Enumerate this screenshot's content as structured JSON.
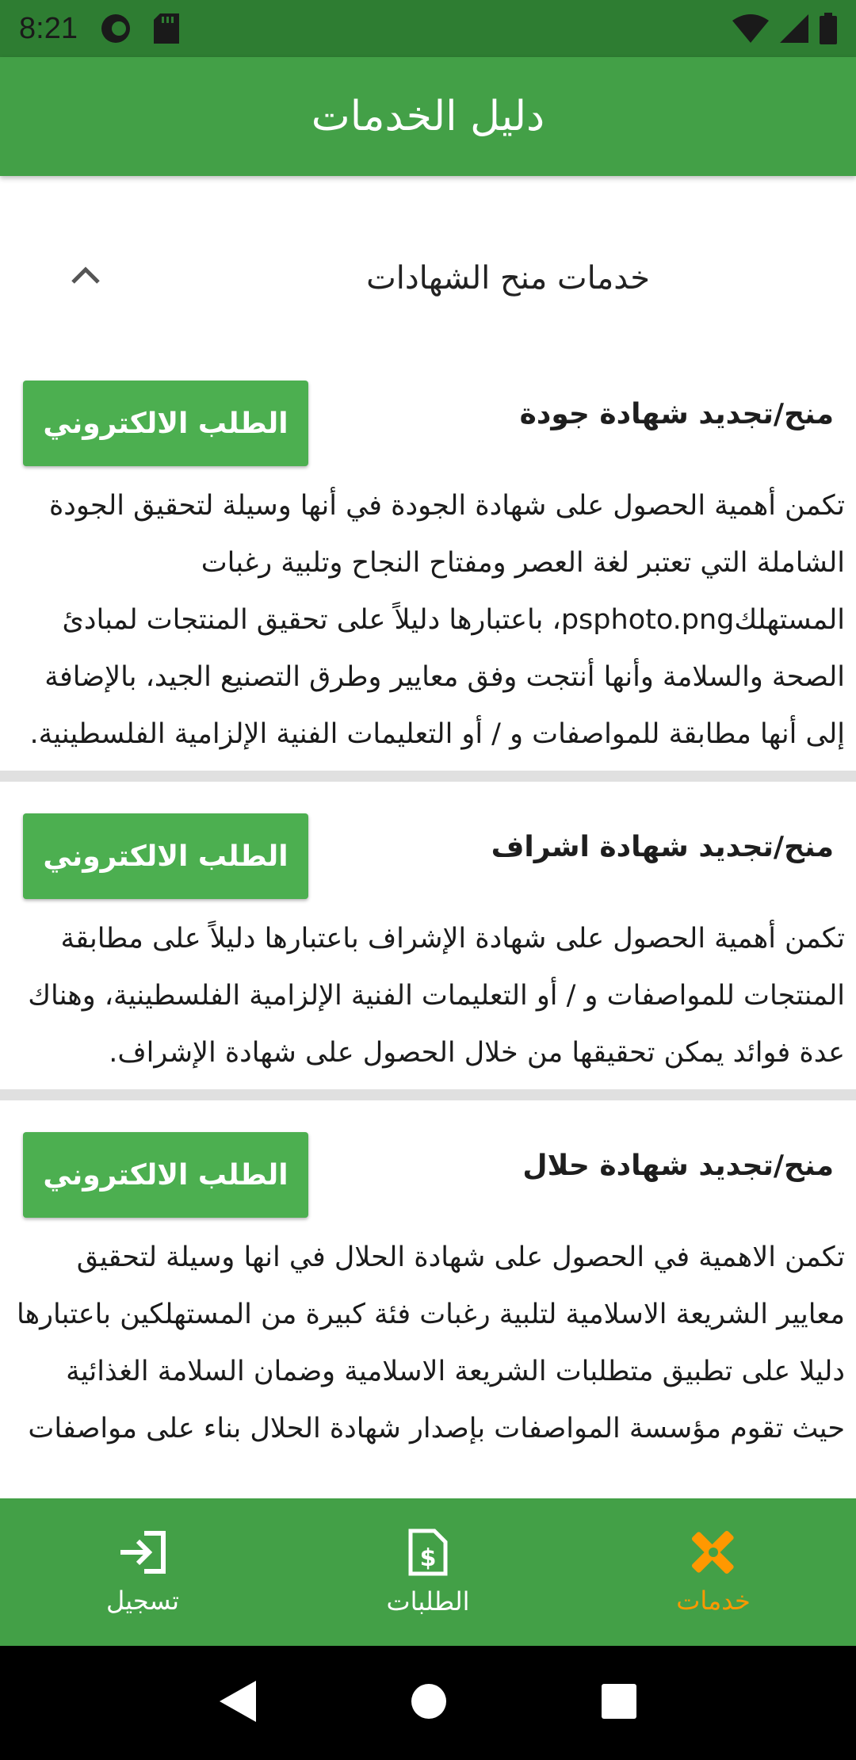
{
  "status_bar": {
    "time": "8:21"
  },
  "app_bar": {
    "title": "دليل الخدمات"
  },
  "section": {
    "title": "خدمات منح الشهادات",
    "expanded": true
  },
  "cards": [
    {
      "title": "منح/تجديد شهادة جودة",
      "button_label": "الطلب الالكتروني",
      "body": "تكمن أهمية الحصول على شهادة الجودة في أنها وسيلة لتحقيق الجودة الشاملة التي تعتبر لغة العصر ومفتاح النجاح وتلبية رغبات المستهلكpsphoto.png، باعتبارها دليلاً على تحقيق المنتجات لمبادئ الصحة والسلامة وأنها أنتجت وفق معايير وطرق التصنيع الجيد، بالإضافة إلى أنها مطابقة للمواصفات و / أو التعليمات الفنية الإلزامية الفلسطينية."
    },
    {
      "title": "منح/تجديد شهادة اشراف",
      "button_label": "الطلب الالكتروني",
      "body": "تكمن أهمية الحصول على شهادة الإشراف باعتبارها دليلاً على مطابقة المنتجات للمواصفات و / أو التعليمات الفنية الإلزامية الفلسطينية، وهناك عدة فوائد يمكن تحقيقها من خلال الحصول على شهادة الإشراف."
    },
    {
      "title": "منح/تجديد شهادة حلال",
      "button_label": "الطلب الالكتروني",
      "body": "تكمن الاهمية في الحصول على شهادة الحلال في انها وسيلة لتحقيق معايير الشريعة الاسلامية لتلبية رغبات فئة كبيرة من المستهلكين باعتبارها دليلا على تطبيق متطلبات الشريعة الاسلامية وضمان السلامة الغذائية حيث تقوم مؤسسة المواصفات بإصدار شهادة الحلال بناء على مواصفات"
    }
  ],
  "bottom_nav": {
    "items": [
      {
        "label": "تسجيل",
        "icon": "login-icon",
        "active": false
      },
      {
        "label": "الطلبات",
        "icon": "invoice-icon",
        "active": false
      },
      {
        "label": "خدمات",
        "icon": "tools-icon",
        "active": true
      }
    ]
  },
  "colors": {
    "primary": "#43a047",
    "primary_dark": "#2e7d32",
    "button": "#4caf50",
    "active_nav": "#ff9800"
  }
}
